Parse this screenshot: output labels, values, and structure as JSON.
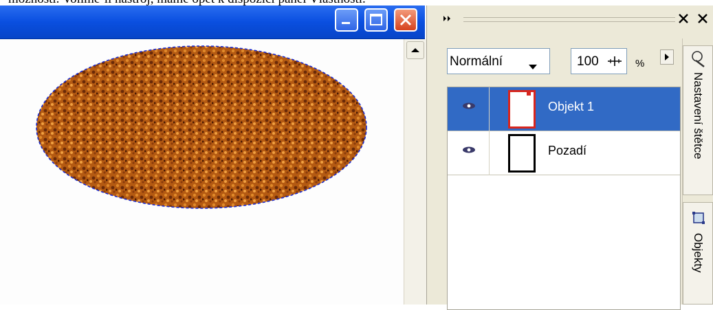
{
  "caption": "možnosti. Volíme-li nástroj, máme opět k dispozici panel Vlastnosti.",
  "window": {
    "title_buttons": [
      "minimize",
      "maximize",
      "close"
    ]
  },
  "panel": {
    "blend_mode": "Normální",
    "opacity": "100",
    "opacity_unit": "%",
    "layers": [
      {
        "name": "Objekt 1",
        "selected": true,
        "thumb_color": "#d8261e"
      },
      {
        "name": "Pozadí",
        "selected": false,
        "thumb_color": "#000000"
      }
    ],
    "side_tabs": [
      "Nastavení štětce",
      "Objekty"
    ]
  },
  "colors": {
    "titlebar": "#0a4fe0",
    "selection": "#316ac5",
    "texture": "#b45a12"
  },
  "icons": [
    "minimize-icon",
    "maximize-icon",
    "close-icon",
    "scroll-up-arrow-icon",
    "expand-icon",
    "close-panel-icon",
    "dropdown-arrow-icon",
    "slider-icon",
    "panel-menu-icon",
    "eye-icon",
    "brush-icon",
    "objects-icon"
  ]
}
